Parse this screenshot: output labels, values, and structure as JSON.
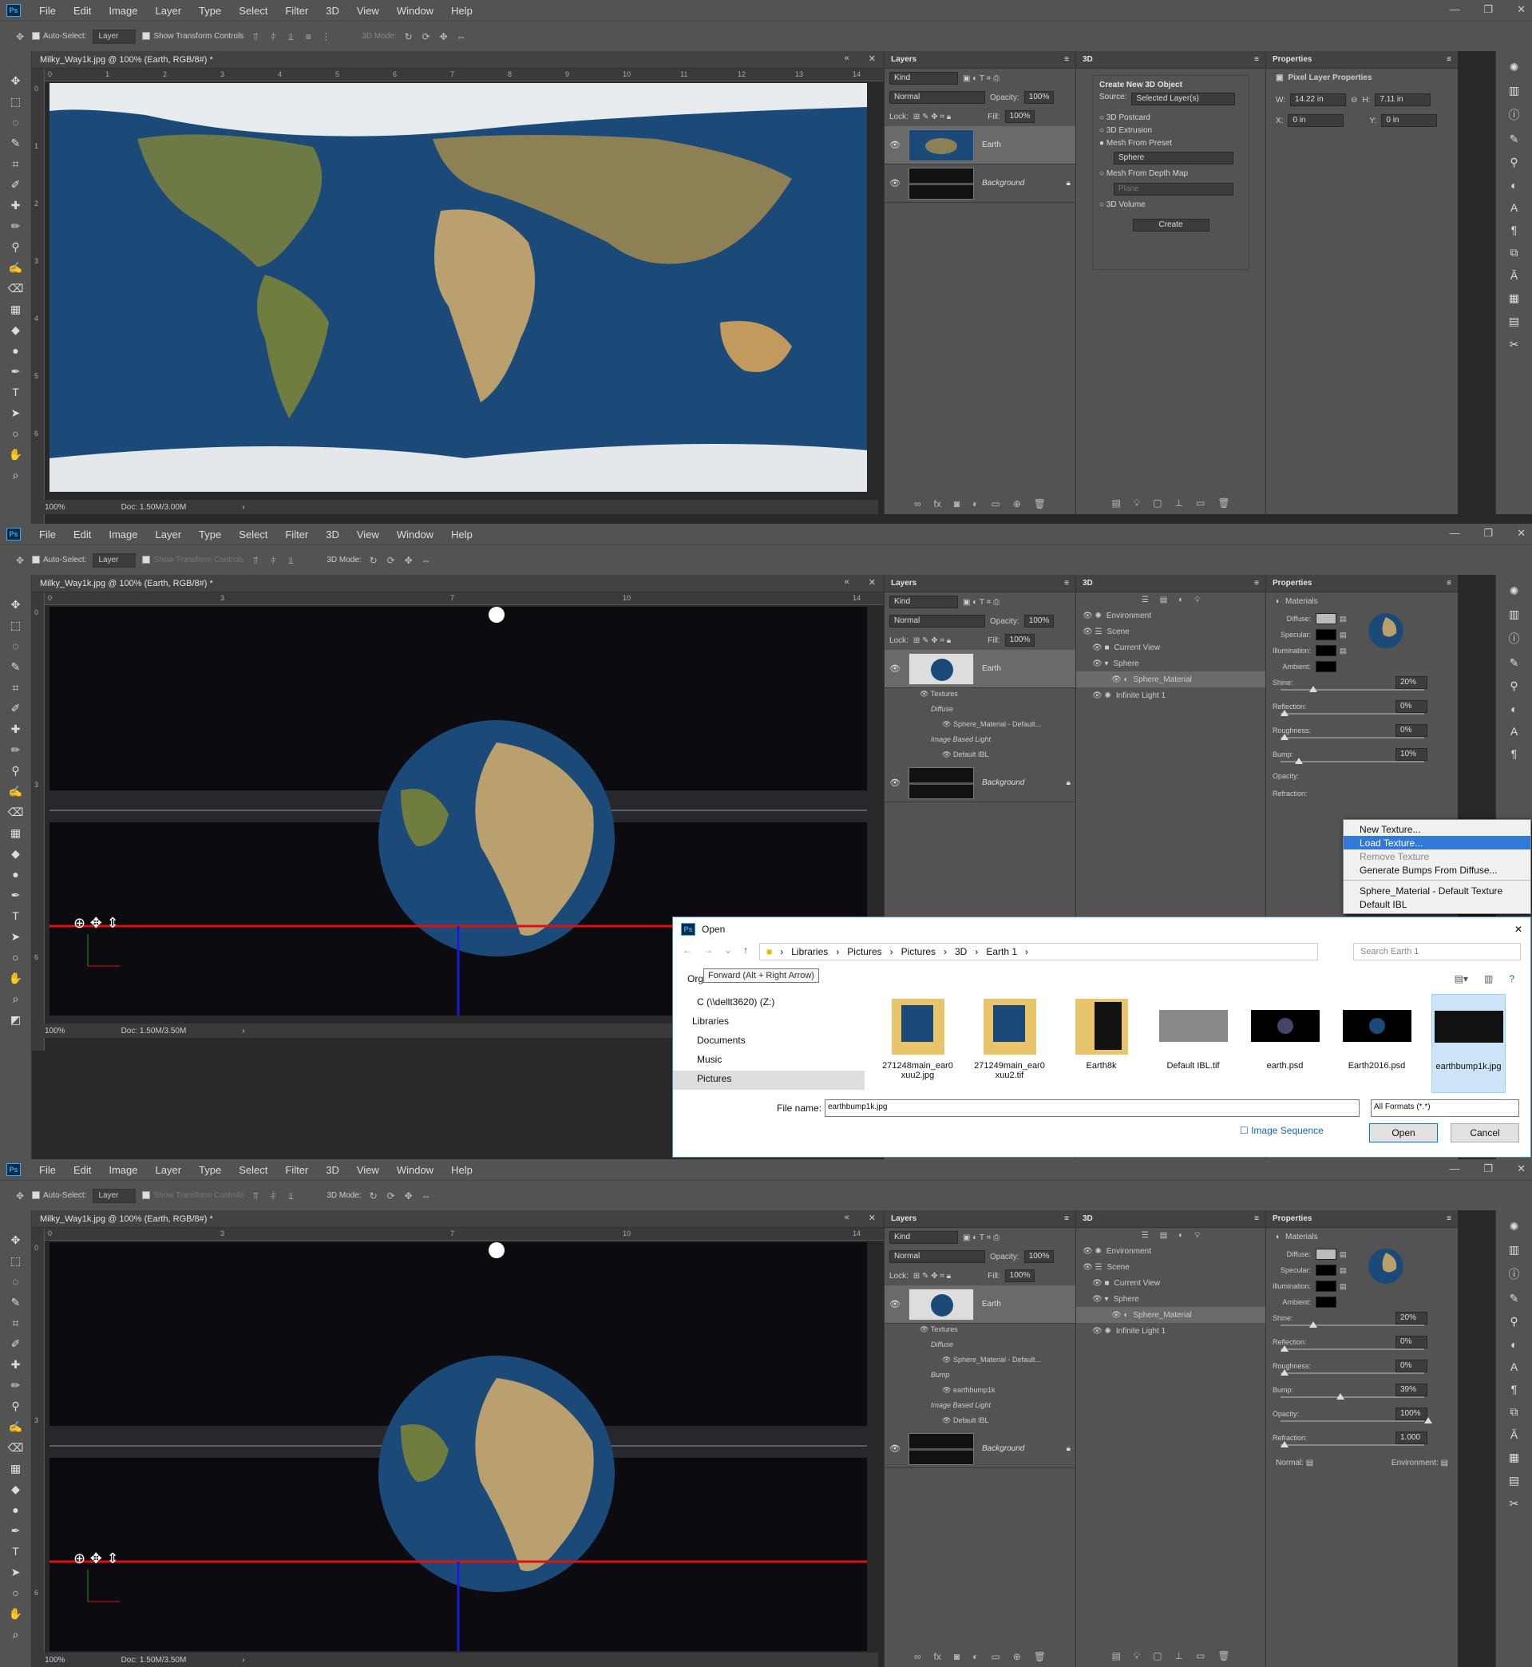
{
  "colors": {
    "ui_bg": "#535353",
    "panel_header": "#424242",
    "canvas_bg": "#282828",
    "ocean": "#1c4a78",
    "land": "#8a7a4c",
    "selection": "#3178d8",
    "axis_red": "#e01010",
    "axis_blue": "#1a1ad8",
    "axis_green": "#10a010"
  },
  "menu": [
    "File",
    "Edit",
    "Image",
    "Layer",
    "Type",
    "Select",
    "Filter",
    "3D",
    "View",
    "Window",
    "Help"
  ],
  "options": {
    "auto_select": "Auto-Select:",
    "layer_select": "Layer",
    "show_transform": "Show Transform Controls",
    "mode_3d": "3D Mode:"
  },
  "doc": {
    "title": "Milky_Way1k.jpg @ 100% (Earth, RGB/8#) *",
    "zoom": "100%",
    "doc_size_1": "Doc: 1.50M/3.00M",
    "doc_size_2": "Doc: 1.50M/3.50M",
    "ruler_h": [
      "0",
      "1",
      "2",
      "3",
      "4",
      "5",
      "6",
      "7",
      "8",
      "9",
      "10",
      "11",
      "12",
      "13",
      "14"
    ],
    "ruler_v": [
      "0",
      "1",
      "2",
      "3",
      "4",
      "5",
      "6"
    ]
  },
  "layers_panel": {
    "title": "Layers",
    "kind": "Kind",
    "blend": "Normal",
    "opacity_label": "Opacity:",
    "opacity": "100%",
    "lock_label": "Lock:",
    "fill_label": "Fill:",
    "fill": "100%",
    "earth": "Earth",
    "background": "Background",
    "textures": "Textures",
    "diffuse": "Diffuse",
    "diffuse_item": "Sphere_Material - Default...",
    "bump": "Bump",
    "bump_item": "earthbump1k",
    "ibl": "Image Based Light",
    "ibl_item": "Default IBL"
  },
  "panel_3d": {
    "title": "3D",
    "create_title": "Create New 3D Object",
    "source_label": "Source:",
    "source": "Selected Layer(s)",
    "opt_postcard": "3D Postcard",
    "opt_extrusion": "3D Extrusion",
    "opt_mesh_preset": "Mesh From Preset",
    "preset": "Sphere",
    "opt_depth": "Mesh From Depth Map",
    "depth": "Plane",
    "opt_volume": "3D Volume",
    "create": "Create",
    "environment": "Environment",
    "scene": "Scene",
    "current_view": "Current View",
    "sphere": "Sphere",
    "sphere_material": "Sphere_Material",
    "infinite_light": "Infinite Light 1"
  },
  "properties": {
    "title": "Properties",
    "pixel_layer": "Pixel Layer Properties",
    "w_label": "W:",
    "w": "14.22 in",
    "h_label": "H:",
    "h": "7.11 in",
    "x_label": "X:",
    "x": "0 in",
    "y_label": "Y:",
    "y": "0 in",
    "materials": "Materials",
    "diffuse": "Diffuse:",
    "specular": "Specular:",
    "illumination": "Illumination:",
    "ambient": "Ambient:",
    "shine": "Shine:",
    "shine_val": "20%",
    "reflection": "Reflection:",
    "reflection_val": "0%",
    "roughness": "Roughness:",
    "roughness_val": "0%",
    "bump": "Bump:",
    "bump_val_1": "10%",
    "bump_val_2": "39%",
    "opacity": "Opacity:",
    "opacity_val": "100%",
    "refraction": "Refraction:",
    "refraction_val": "1.000",
    "normal": "Normal:",
    "environment": "Environment:"
  },
  "context_menu": {
    "new_texture": "New Texture...",
    "load_texture": "Load Texture...",
    "remove_texture": "Remove Texture",
    "generate_bumps": "Generate Bumps From Diffuse...",
    "sphere_default": "Sphere_Material - Default Texture",
    "default_ibl": "Default IBL"
  },
  "open_dialog": {
    "title": "Open",
    "path": [
      "Libraries",
      "Pictures",
      "Pictures",
      "3D",
      "Earth 1"
    ],
    "search_placeholder": "Search Earth 1",
    "organize": "Org",
    "tooltip": "Forward (Alt + Right Arrow)",
    "nav": [
      "C (\\\\dellt3620) (Z:)",
      "Libraries",
      "Documents",
      "Music",
      "Pictures"
    ],
    "files": [
      "271248main_ear0 xuu2.jpg",
      "271249main_ear0 xuu2.tif",
      "Earth8k",
      "Default IBL.tif",
      "earth.psd",
      "Earth2016.psd",
      "earthbump1k.jpg"
    ],
    "file_name_label": "File name:",
    "file_name": "earthbump1k.jpg",
    "format": "All Formats (*.*)",
    "image_sequence": "Image Sequence",
    "open": "Open",
    "cancel": "Cancel"
  }
}
